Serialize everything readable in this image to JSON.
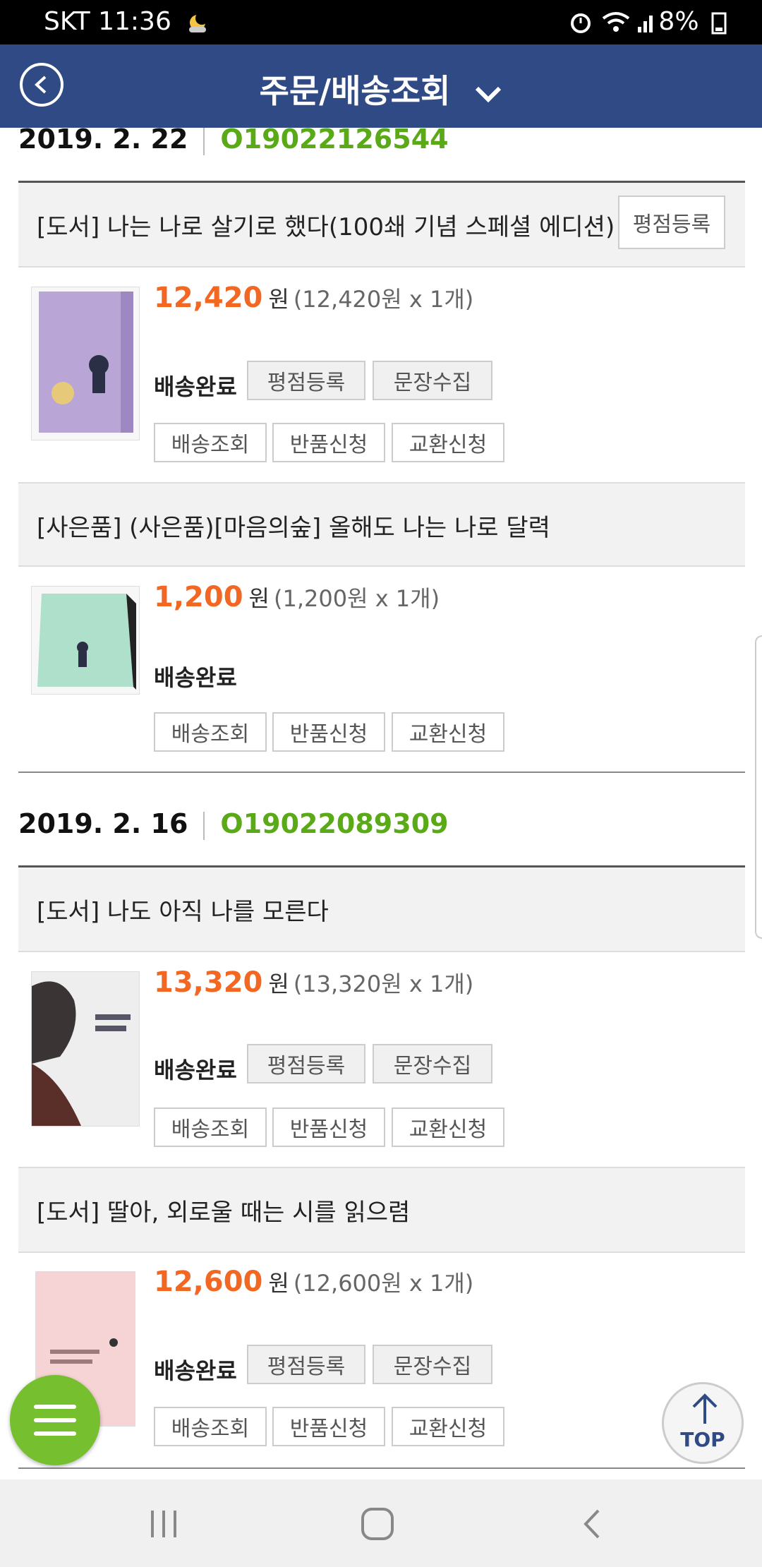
{
  "status_bar": {
    "left": "SKT 11:36",
    "right": "8%"
  },
  "header": {
    "title": "주문/배송조회"
  },
  "orders": [
    {
      "date": "2019. 2. 22",
      "order_no": "O19022126544",
      "items": [
        {
          "title": "[도서] 나는 나로 살기로 했다(100쇄 기념 스페셜 에디션)",
          "title_button": "평점등록",
          "price": "12,420",
          "unit": "원",
          "detail": "(12,420원 x 1개)",
          "status": "배송완료",
          "buttons_row1": [
            "평점등록",
            "문장수집"
          ],
          "buttons_row2": [
            "배송조회",
            "반품신청",
            "교환신청"
          ]
        },
        {
          "title": "[사은품] (사은품)[마음의숲] 올해도 나는 나로 달력",
          "price": "1,200",
          "unit": "원",
          "detail": "(1,200원 x 1개)",
          "status": "배송완료",
          "buttons_row2": [
            "배송조회",
            "반품신청",
            "교환신청"
          ]
        }
      ]
    },
    {
      "date": "2019. 2. 16",
      "order_no": "O19022089309",
      "items": [
        {
          "title": "[도서] 나도 아직 나를 모른다",
          "price": "13,320",
          "unit": "원",
          "detail": "(13,320원 x 1개)",
          "status": "배송완료",
          "buttons_row1": [
            "평점등록",
            "문장수집"
          ],
          "buttons_row2": [
            "배송조회",
            "반품신청",
            "교환신청"
          ]
        },
        {
          "title": "[도서] 딸아, 외로울 때는 시를 읽으렴",
          "price": "12,600",
          "unit": "원",
          "detail": "(12,600원 x 1개)",
          "status": "배송완료",
          "buttons_row1": [
            "평점등록",
            "문장수집"
          ],
          "buttons_row2": [
            "배송조회",
            "반품신청",
            "교환신청"
          ]
        }
      ]
    }
  ],
  "fab_top": {
    "label": "TOP"
  },
  "colors": {
    "header": "#2f4a84",
    "price": "#f26722",
    "order_no": "#5aaa17",
    "fab_menu": "#76bf2f"
  }
}
